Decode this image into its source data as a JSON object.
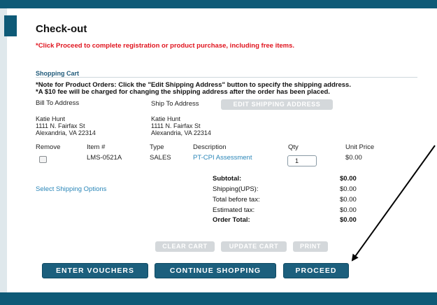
{
  "page": {
    "title": "Check-out",
    "notice": "*Click Proceed to complete registration or product purchase, including free items."
  },
  "cart": {
    "heading": "Shopping Cart",
    "note1": "*Note for Product Orders: Click the \"Edit Shipping Address\" button to specify the shipping address.",
    "note2": "*A $10 fee will be charged for changing the shipping address after the order has been placed.",
    "bill_to_label": "Bill To Address",
    "ship_to_label": "Ship To Address",
    "edit_shipping_button": "EDIT SHIPPING ADDRESS",
    "bill_to": {
      "name": "Katie Hunt",
      "street": "1111 N. Fairfax St",
      "city": "Alexandria, VA 22314"
    },
    "ship_to": {
      "name": "Katie Hunt",
      "street": "1111 N. Fairfax St",
      "city": "Alexandria, VA 22314"
    },
    "columns": [
      "Remove",
      "Item #",
      "Type",
      "Description",
      "Qty",
      "Unit Price"
    ],
    "items": [
      {
        "item_no": "LMS-0521A",
        "type": "SALES",
        "description": "PT-CPI Assessment",
        "qty": "1",
        "unit_price": "$0.00"
      }
    ],
    "shipping_link": "Select Shipping Options",
    "totals": [
      {
        "label": "Subtotal:",
        "value": "$0.00",
        "bold": true
      },
      {
        "label": "Shipping(UPS):",
        "value": "$0.00",
        "bold": false
      },
      {
        "label": "Total before tax:",
        "value": "$0.00",
        "bold": false
      },
      {
        "label": "Estimated tax:",
        "value": "$0.00",
        "bold": false
      },
      {
        "label": "Order Total:",
        "value": "$0.00",
        "bold": true
      }
    ],
    "actions": {
      "clear": "CLEAR CART",
      "update": "UPDATE CART",
      "print": "PRINT"
    }
  },
  "footer_buttons": {
    "vouchers": "ENTER VOUCHERS",
    "continue": "CONTINUE SHOPPING",
    "proceed": "PROCEED"
  },
  "colors": {
    "brand": "#1c5f7d",
    "notice": "#e0141e",
    "link": "#2a86b8",
    "disabled": "#d4d8db"
  },
  "annotation": {
    "type": "arrow",
    "points_to": "proceed-button"
  }
}
